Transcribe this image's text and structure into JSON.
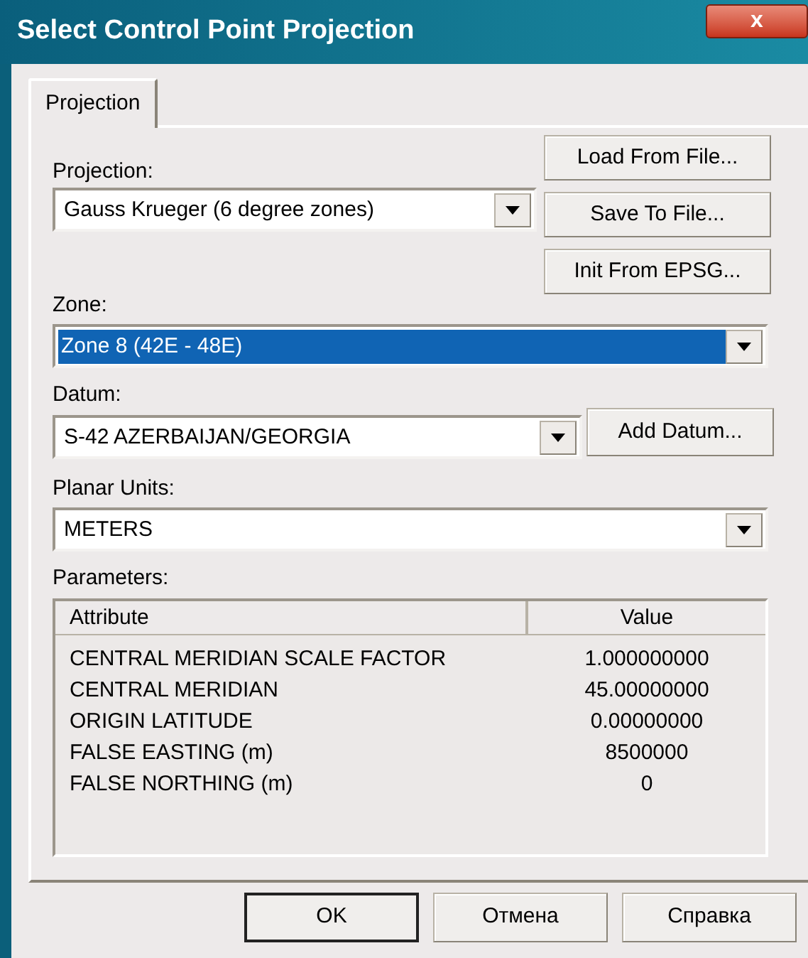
{
  "window": {
    "title": "Select Control Point Projection",
    "close": "x"
  },
  "tabs": [
    {
      "label": "Projection",
      "selected": true
    }
  ],
  "projection": {
    "label": "Projection:",
    "value": "Gauss Krueger (6 degree zones)",
    "focused": false
  },
  "side_buttons": [
    "Load From File...",
    "Save To File...",
    "Init From EPSG..."
  ],
  "zone": {
    "label": "Zone:",
    "value": "Zone 8 (42E - 48E)",
    "focused": true
  },
  "datum": {
    "label": "Datum:",
    "value": "S-42 AZERBAIJAN/GEORGIA",
    "focused": false,
    "button": "Add Datum..."
  },
  "planar_units": {
    "label": "Planar Units:",
    "value": "METERS",
    "focused": false
  },
  "parameters": {
    "label": "Parameters:",
    "columns": [
      "Attribute",
      "Value"
    ],
    "rows": [
      [
        "CENTRAL MERIDIAN SCALE FACTOR",
        "1.000000000"
      ],
      [
        "CENTRAL MERIDIAN",
        "45.00000000"
      ],
      [
        "ORIGIN LATITUDE",
        "0.00000000"
      ],
      [
        "FALSE EASTING (m)",
        "8500000"
      ],
      [
        "FALSE NORTHING (m)",
        "0"
      ]
    ]
  },
  "buttons": [
    {
      "label": "OK",
      "default": true
    },
    {
      "label": "Отмена",
      "default": false
    },
    {
      "label": "Справка",
      "default": false
    }
  ]
}
